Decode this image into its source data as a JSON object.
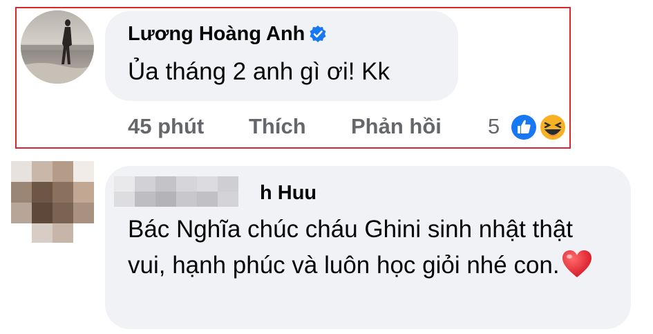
{
  "comments": [
    {
      "author": "Lương Hoàng Anh",
      "verified": true,
      "text": "Ủa tháng 2 anh gì ơi! Kk",
      "time": "45 phút",
      "like_label": "Thích",
      "reply_label": "Phản hồi",
      "reaction_count": "5",
      "reactions": [
        "like-icon",
        "haha-icon"
      ]
    },
    {
      "author_visible": "h Huu",
      "author_blurred": true,
      "text": "Bác Nghĩa chúc cháu Ghini sinh nhật thật vui, hạnh phúc và luôn học giỏi nhé con.",
      "emoji": "heart-icon"
    }
  ],
  "colors": {
    "highlight_border": "#d9252e",
    "bubble_bg": "#f0f2f5",
    "verified_blue": "#1877f2",
    "meta_gray": "#65676b",
    "heart_red": "#e41e3f"
  }
}
